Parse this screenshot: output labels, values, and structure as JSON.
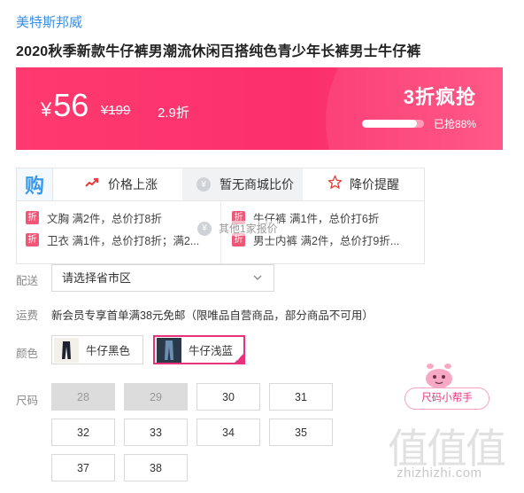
{
  "product": {
    "brand": "美特斯邦威",
    "title": "2020秋季新款牛仔裤男潮流休闲百搭纯色青少年长裤男士牛仔裤"
  },
  "price": {
    "currency": "¥",
    "current": "56",
    "original": "¥199",
    "discount": "2.9折",
    "promo_title": "3折疯抢",
    "sold_text": "已抢88%",
    "sold_fraction": 0.88
  },
  "tools": {
    "buy_icon": "购",
    "price_rise": "价格上涨",
    "compare": "暂无商城比价",
    "compare_icon": "¥",
    "remind": "降价提醒",
    "other_price": "其他1家报价"
  },
  "promos": {
    "tag": "折",
    "left": [
      "文胸 满2件，总价打8折",
      "卫衣 满1件，总价打8折；满2..."
    ],
    "right": [
      "牛仔裤 满1件，总价打6折",
      "男士内裤 满2件，总价打9折..."
    ]
  },
  "delivery": {
    "label": "配送",
    "placeholder": "请选择省市区"
  },
  "shipping": {
    "label": "运费",
    "text": "新会员专享首单满38元免邮（限唯品自营商品，部分商品不可用）"
  },
  "color": {
    "label": "颜色",
    "options": [
      {
        "name": "牛仔黑色",
        "selected": false,
        "swatch": "#1e2230"
      },
      {
        "name": "牛仔浅蓝",
        "selected": true,
        "swatch": "#4a6a8c"
      }
    ]
  },
  "size": {
    "label": "尺码",
    "options": [
      {
        "value": "28",
        "disabled": true
      },
      {
        "value": "29",
        "disabled": true
      },
      {
        "value": "30",
        "disabled": false
      },
      {
        "value": "31",
        "disabled": false
      },
      {
        "value": "32",
        "disabled": false
      },
      {
        "value": "33",
        "disabled": false
      },
      {
        "value": "34",
        "disabled": false
      },
      {
        "value": "35",
        "disabled": false
      },
      {
        "value": "37",
        "disabled": false
      },
      {
        "value": "38",
        "disabled": false
      }
    ],
    "helper": "尺码小帮手"
  },
  "watermark": {
    "chars": "值值值",
    "url": "zhizhizhi.com"
  },
  "colors": {
    "accent": "#fb2f6b",
    "brand_link": "#3a8ee6",
    "tag": "#f25676",
    "selected_border": "#e8337c"
  }
}
